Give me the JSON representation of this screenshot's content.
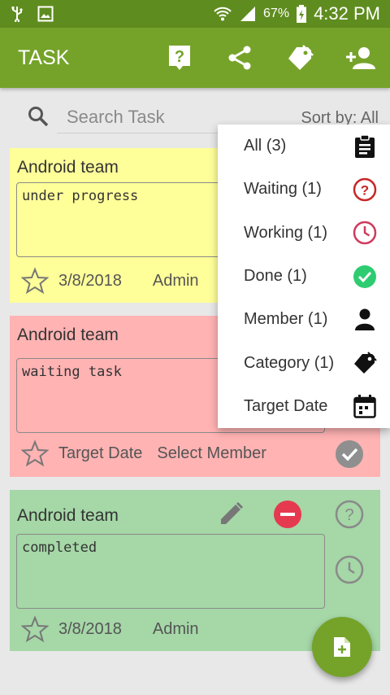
{
  "statusbar": {
    "battery_pct": "67%",
    "time": "4:32 PM"
  },
  "appbar": {
    "title": "TASK"
  },
  "search": {
    "placeholder": "Search Task",
    "sort_label": "Sort by: All"
  },
  "cards": [
    {
      "team": "Android team",
      "note": "under progress",
      "date": "3/8/2018",
      "member": "Admin"
    },
    {
      "team": "Android team",
      "note": "waiting task",
      "date": "Target Date",
      "member": "Select Member"
    },
    {
      "team": "Android team",
      "note": "completed",
      "date": "3/8/2018",
      "member": "Admin"
    }
  ],
  "menu": {
    "items": [
      {
        "label": "All (3)",
        "icon": "clipboard-icon"
      },
      {
        "label": "Waiting (1)",
        "icon": "question-circle-icon"
      },
      {
        "label": "Working (1)",
        "icon": "clock-icon"
      },
      {
        "label": "Done (1)",
        "icon": "check-circle-icon"
      },
      {
        "label": "Member (1)",
        "icon": "person-icon"
      },
      {
        "label": "Category (1)",
        "icon": "tag-icon"
      },
      {
        "label": "Target Date",
        "icon": "calendar-icon"
      }
    ]
  },
  "colors": {
    "primary": "#75a32a",
    "statusbar": "#5f8c1f",
    "yellow": "#ffff99",
    "red": "#ffb3b3",
    "green": "#a5d7a7",
    "danger": "#e53950",
    "done": "#2ecc71",
    "waiting": "#c62828"
  }
}
